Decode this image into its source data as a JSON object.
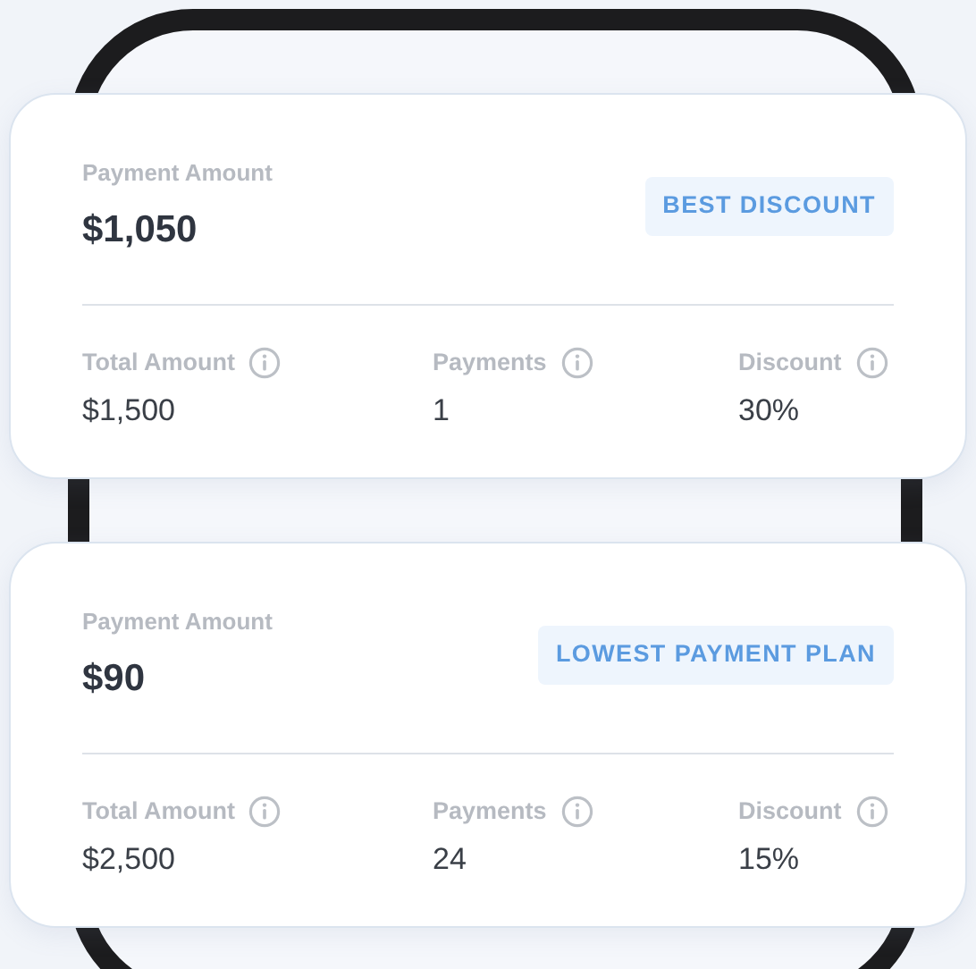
{
  "plans": [
    {
      "amount_label": "Payment Amount",
      "amount": "$1,050",
      "tag": "BEST DISCOUNT",
      "stats": [
        {
          "label": "Total Amount",
          "value": "$1,500"
        },
        {
          "label": "Payments",
          "value": "1"
        },
        {
          "label": "Discount",
          "value": "30%"
        }
      ]
    },
    {
      "amount_label": "Payment Amount",
      "amount": "$90",
      "tag": "LOWEST PAYMENT PLAN",
      "stats": [
        {
          "label": "Total Amount",
          "value": "$2,500"
        },
        {
          "label": "Payments",
          "value": "24"
        },
        {
          "label": "Discount",
          "value": "15%"
        }
      ]
    }
  ]
}
